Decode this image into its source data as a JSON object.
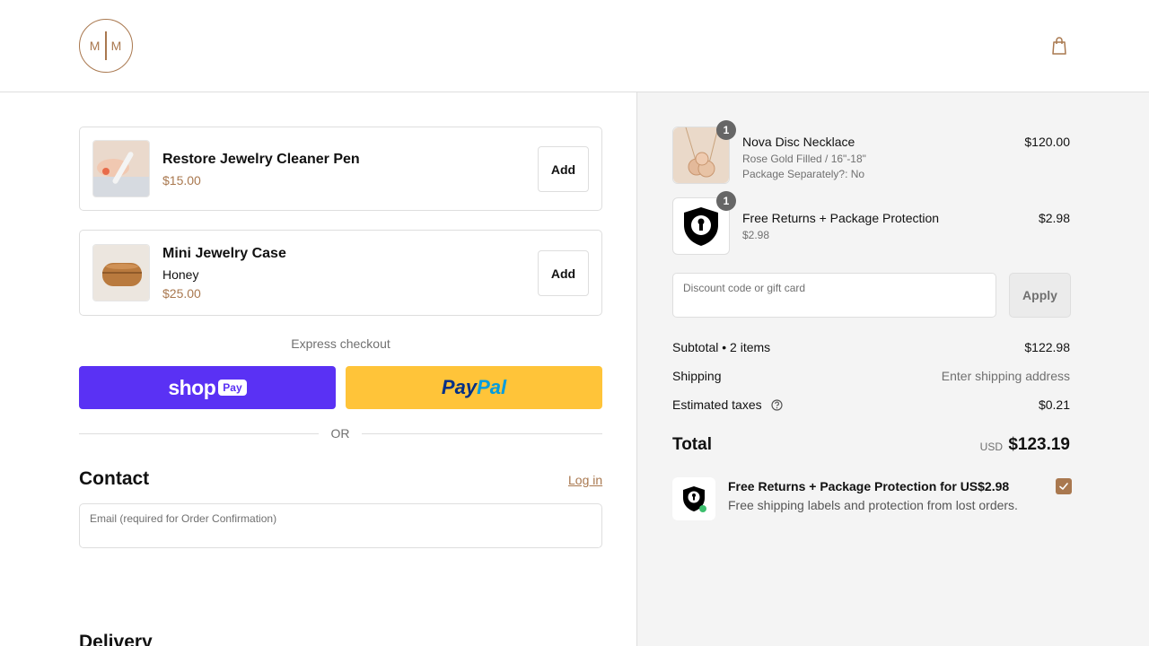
{
  "brand": {
    "logo_letters_left": "M",
    "logo_letters_right": "M",
    "accent_color": "#a9784f"
  },
  "header": {
    "cart_icon": "shopping-bag-icon"
  },
  "upsells": [
    {
      "title": "Restore Jewelry Cleaner Pen",
      "variant": "",
      "price": "$15.00",
      "button": "Add"
    },
    {
      "title": "Mini Jewelry Case",
      "variant": "Honey",
      "price": "$25.00",
      "button": "Add"
    }
  ],
  "express": {
    "label": "Express checkout",
    "shop_pay": {
      "word": "shop",
      "badge": "Pay",
      "color": "#5a31f4"
    },
    "paypal": {
      "part1": "Pay",
      "part2": "Pal",
      "color": "#ffc439"
    },
    "or_label": "OR"
  },
  "contact": {
    "title": "Contact",
    "login_link": "Log in",
    "email_label": "Email (required for Order Confirmation)"
  },
  "delivery": {
    "title": "Delivery"
  },
  "order": {
    "items": [
      {
        "name": "Nova Disc Necklace",
        "sub1": "Rose Gold Filled / 16\"-18\"",
        "sub2": "Package Separately?: No",
        "price": "$120.00",
        "qty": "1"
      },
      {
        "name": "Free Returns + Package Protection",
        "sub1": "$2.98",
        "price": "$2.98",
        "qty": "1"
      }
    ],
    "discount": {
      "label": "Discount code or gift card",
      "button": "Apply"
    },
    "summary": {
      "subtotal_label": "Subtotal • 2 items",
      "subtotal_value": "$122.98",
      "shipping_label": "Shipping",
      "shipping_value": "Enter shipping address",
      "taxes_label": "Estimated taxes",
      "taxes_value": "$0.21"
    },
    "total": {
      "label": "Total",
      "currency": "USD",
      "value": "$123.19"
    },
    "protection": {
      "title": "Free Returns + Package Protection for US$2.98",
      "description": "Free shipping labels and protection from lost orders.",
      "checked": true
    }
  }
}
